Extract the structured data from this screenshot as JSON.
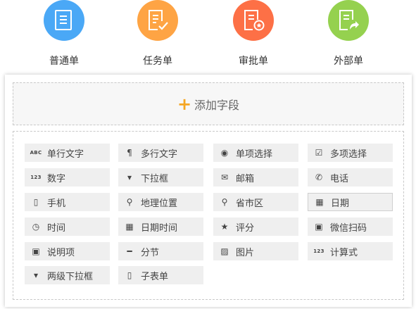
{
  "form_types": [
    {
      "label": "普通单",
      "icon": "document-list-icon",
      "color": "#4aa8f6"
    },
    {
      "label": "任务单",
      "icon": "document-check-icon",
      "color": "#fea444"
    },
    {
      "label": "审批单",
      "icon": "document-approve-icon",
      "color": "#fd7046"
    },
    {
      "label": "外部单",
      "icon": "document-share-icon",
      "color": "#95d14f"
    }
  ],
  "add_field": {
    "plus": "+",
    "label": "添加字段",
    "accent": "#f5a623"
  },
  "fields": [
    {
      "label": "单行文字",
      "icon": "abc-text-icon",
      "glyph": "ABC"
    },
    {
      "label": "多行文字",
      "icon": "paragraph-icon",
      "glyph": "¶"
    },
    {
      "label": "单项选择",
      "icon": "radio-icon",
      "glyph": "◉"
    },
    {
      "label": "多项选择",
      "icon": "checkbox-icon",
      "glyph": "☑"
    },
    {
      "label": "数字",
      "icon": "number-icon",
      "glyph": "123"
    },
    {
      "label": "下拉框",
      "icon": "dropdown-icon",
      "glyph": "▾"
    },
    {
      "label": "邮箱",
      "icon": "envelope-icon",
      "glyph": "✉"
    },
    {
      "label": "电话",
      "icon": "phone-icon",
      "glyph": "✆"
    },
    {
      "label": "手机",
      "icon": "mobile-icon",
      "glyph": "▯"
    },
    {
      "label": "地理位置",
      "icon": "map-pin-icon",
      "glyph": "⚲"
    },
    {
      "label": "省市区",
      "icon": "map-pin-icon",
      "glyph": "⚲"
    },
    {
      "label": "日期",
      "icon": "calendar-icon",
      "glyph": "▦"
    },
    {
      "label": "时间",
      "icon": "clock-icon",
      "glyph": "◷"
    },
    {
      "label": "日期时间",
      "icon": "calendar-icon",
      "glyph": "▦"
    },
    {
      "label": "评分",
      "icon": "star-icon",
      "glyph": "★"
    },
    {
      "label": "微信扫码",
      "icon": "scan-icon",
      "glyph": "▣"
    },
    {
      "label": "说明项",
      "icon": "info-card-icon",
      "glyph": "▣"
    },
    {
      "label": "分节",
      "icon": "divider-icon",
      "glyph": "━"
    },
    {
      "label": "图片",
      "icon": "image-icon",
      "glyph": "▨"
    },
    {
      "label": "计算式",
      "icon": "formula-icon",
      "glyph": "123"
    },
    {
      "label": "两级下拉框",
      "icon": "dropdown-icon",
      "glyph": "▾"
    },
    {
      "label": "子表单",
      "icon": "file-icon",
      "glyph": "▯"
    }
  ]
}
